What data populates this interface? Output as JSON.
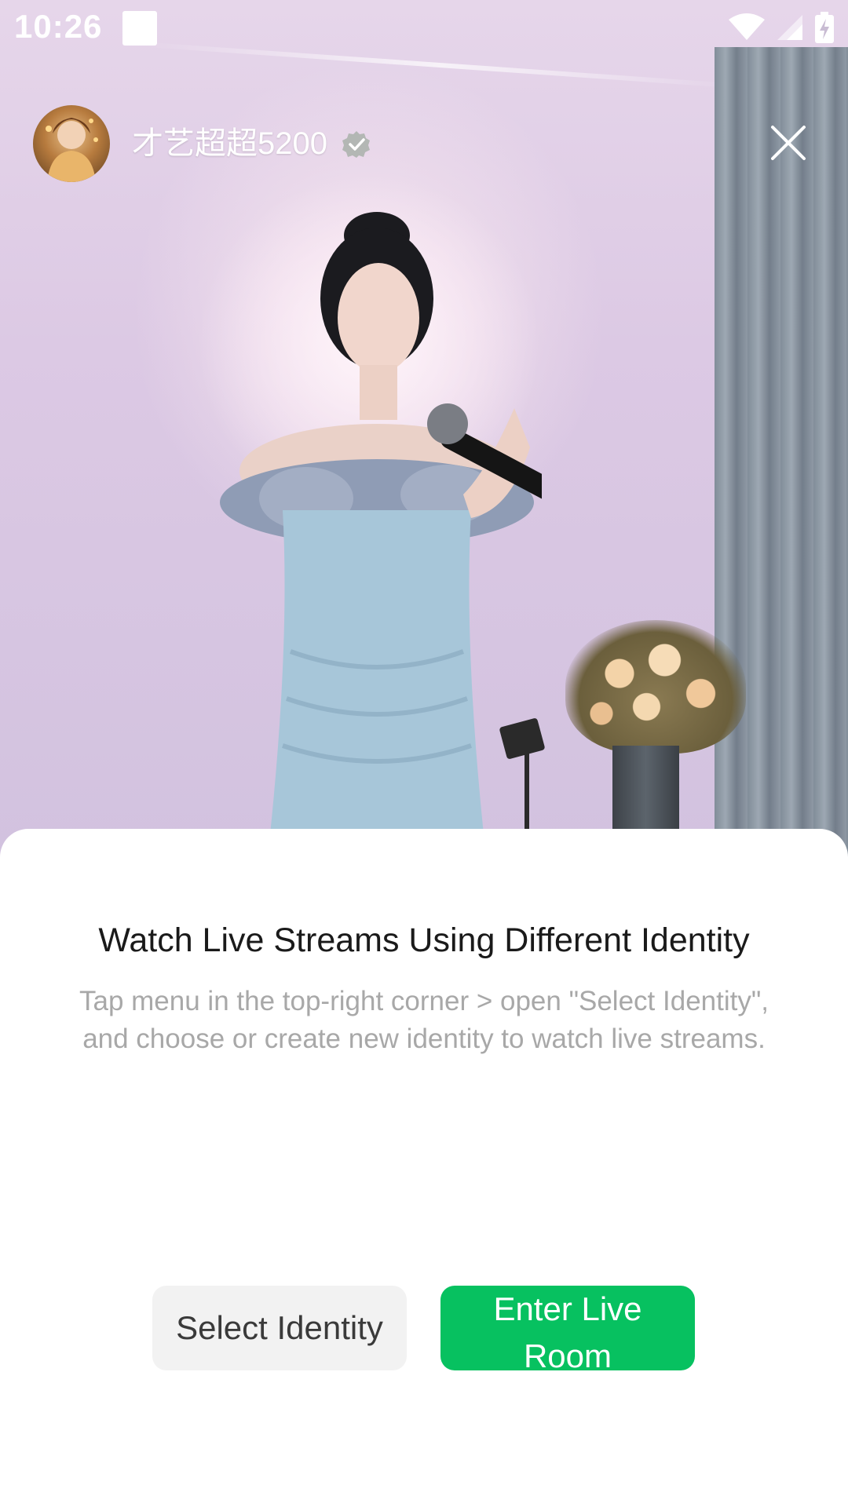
{
  "status_bar": {
    "time": "10:26"
  },
  "stream": {
    "streamer_name": "才艺超超5200",
    "verified_icon": "verified-badge-icon",
    "close_icon": "close-icon"
  },
  "sheet": {
    "title": "Watch Live Streams Using Different Identity",
    "description": "Tap menu in the top-right corner > open \"Select Identity\", and choose or create new identity to watch live streams.",
    "buttons": {
      "select_identity": "Select Identity",
      "enter_live_room": "Enter Live Room"
    }
  },
  "colors": {
    "primary": "#07c160",
    "secondary_bg": "#f2f2f2",
    "title_text": "#1a1a1a",
    "description_text": "#a8a8a8"
  }
}
